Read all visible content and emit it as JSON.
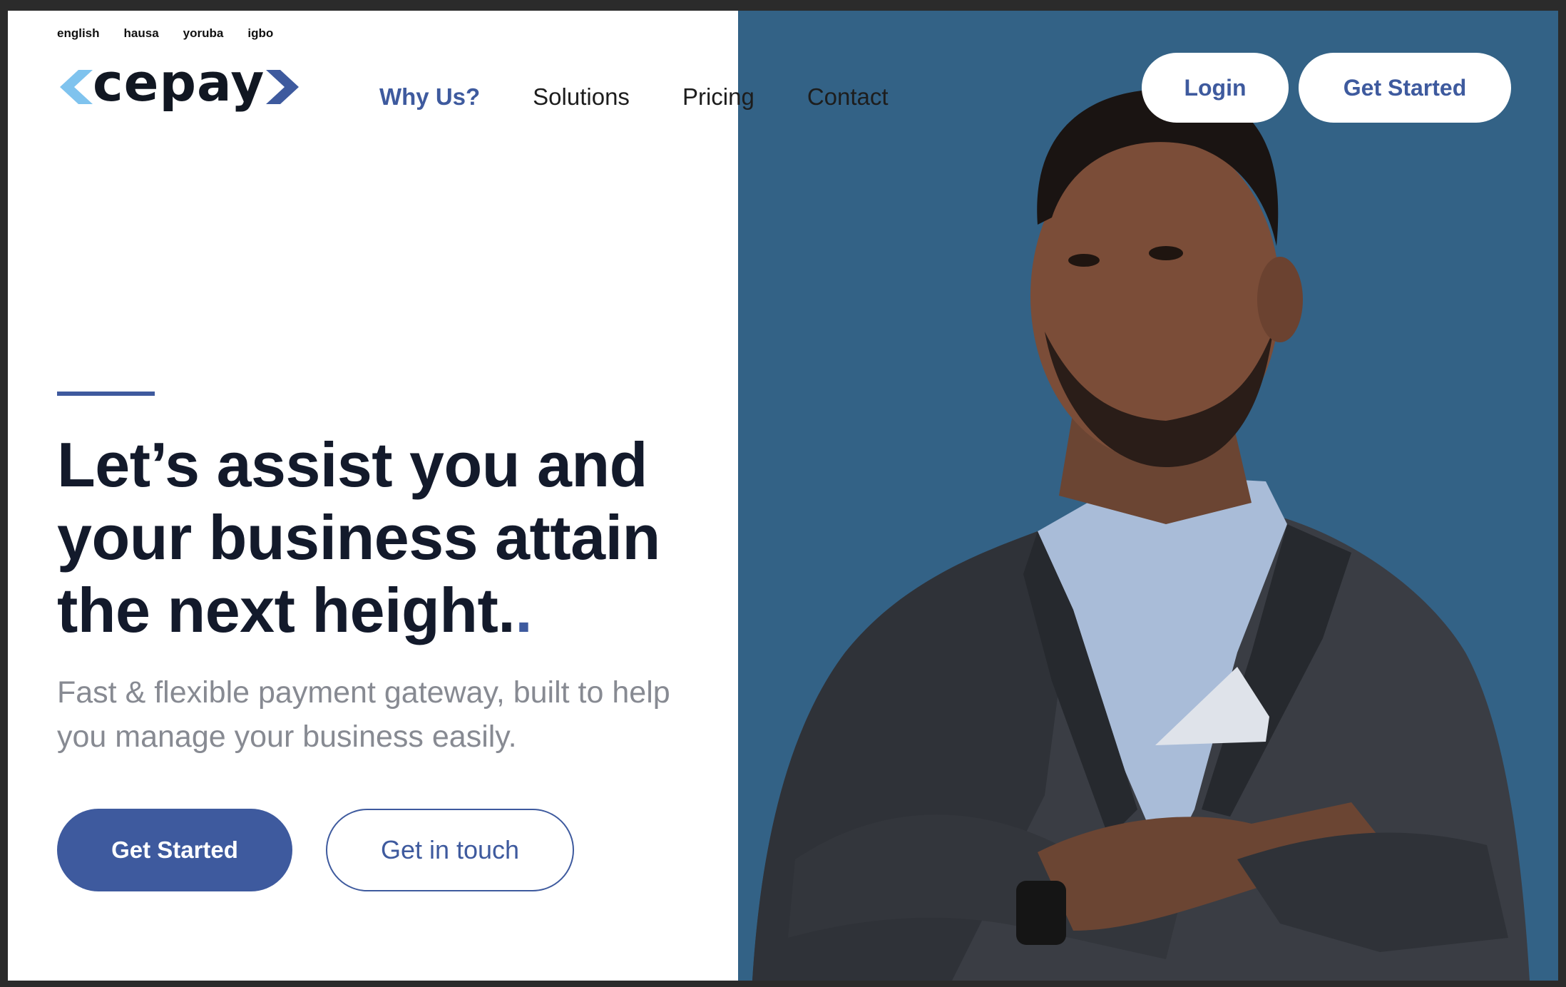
{
  "languages": [
    "english",
    "hausa",
    "yoruba",
    "igbo"
  ],
  "brand": {
    "name": "cepay",
    "accent": "#3e5a9e",
    "accent_light": "#7fc3ee",
    "panel": "#336286",
    "ink": "#131a2b"
  },
  "nav": {
    "items": [
      "Why Us?",
      "Solutions",
      "Pricing",
      "Contact"
    ],
    "active": "Why Us?",
    "login_label": "Login",
    "get_started_label": "Get Started"
  },
  "hero": {
    "headline": "Let’s assist you and your business attain the next height.",
    "headline_dot": ".",
    "subline": "Fast & flexible payment gateway, built to help you manage your business easily.",
    "primary_cta": "Get Started",
    "secondary_cta": "Get in touch"
  },
  "image": {
    "subject": "portrait-man-crossed-arms"
  }
}
